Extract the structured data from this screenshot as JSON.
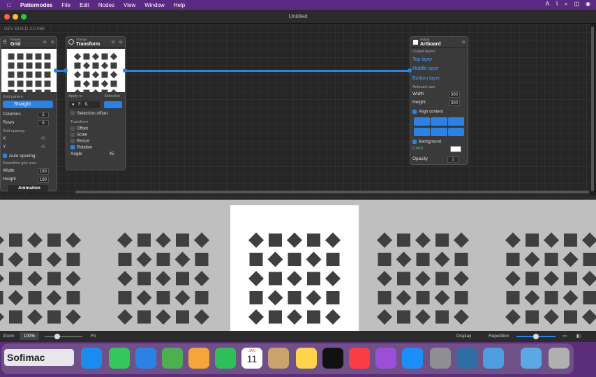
{
  "menubar": {
    "app": "Patternodes",
    "items": [
      "File",
      "Edit",
      "Nodes",
      "View",
      "Window",
      "Help"
    ]
  },
  "window": {
    "title": "Untitled",
    "build": "DEV BUILD 3.0.068"
  },
  "grid_node": {
    "subtitle": "Repeat",
    "title": "Grid",
    "pattern_label": "Grid pattern",
    "pattern_value": "Straight",
    "columns_label": "Columns",
    "columns": "5",
    "rows_label": "Rows",
    "rows": "5",
    "spacing_label": "Grid spacing",
    "x_label": "X",
    "x": "45",
    "y_label": "Y",
    "y": "45",
    "auto_spacing": "Auto spacing",
    "rep_area_label": "Repetition grid area",
    "width_label": "Width",
    "width": "180",
    "height_label": "Height",
    "height": "180",
    "animation": "Animation"
  },
  "transform_node": {
    "subtitle": "Change",
    "title": "Transform",
    "apply_to": "Apply to",
    "selection": "Selection",
    "selection_offset": "Selection offset",
    "transform_label": "Transform",
    "offset": "Offset",
    "scale": "Scale",
    "resize": "Resize",
    "rotation": "Rotation",
    "angle_label": "Angle",
    "angle": "45"
  },
  "output_node": {
    "subtitle": "Output",
    "title": "Artboard",
    "layers_label": "Output layers",
    "top": "Top layer",
    "middle": "Middle layer",
    "bottom": "Bottom layer",
    "size_label": "Artboard size",
    "width_label": "Width",
    "width": "300",
    "height_label": "Height",
    "height": "300",
    "align_label": "Align content",
    "background_label": "Background",
    "color_label": "Color",
    "opacity_label": "Opacity",
    "opacity": "1"
  },
  "bottombar": {
    "zoom_label": "Zoom",
    "zoom": "100%",
    "fit": "Fit",
    "display": "Display",
    "repetition": "Repetition"
  },
  "colors": {
    "accent": "#2a82e4",
    "shape": "#3f3f3f",
    "menubar": "#5a2a82"
  },
  "dock": {
    "items": [
      "Finder",
      "Launchpad",
      "Safari",
      "Messages",
      "Mail",
      "Maps",
      "Photos",
      "FaceTime",
      "Calendar",
      "Contacts",
      "Notes",
      "Apple TV",
      "Music",
      "Podcasts",
      "App Store",
      "System Preferences",
      "Patternodes",
      "Pages",
      "Downloads",
      "Trash"
    ],
    "calendar_month": "JAN",
    "calendar_day": "11",
    "watermark": "Sofimac"
  }
}
